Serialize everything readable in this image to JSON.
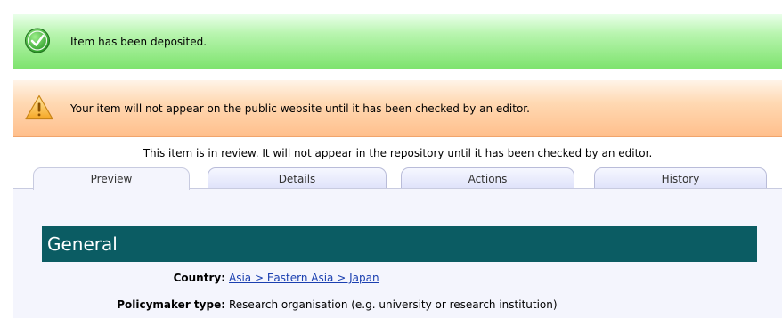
{
  "messages": {
    "success": "Item has been deposited.",
    "warning": "Your item will not appear on the public website until it has been checked by an editor."
  },
  "review_note": "This item is in review. It will not appear in the repository until it has been checked by an editor.",
  "tabs": [
    {
      "label": "Preview",
      "active": true
    },
    {
      "label": "Details",
      "active": false
    },
    {
      "label": "Actions",
      "active": false
    },
    {
      "label": "History",
      "active": false
    }
  ],
  "section": {
    "title": "General",
    "fields": [
      {
        "label": "Country:",
        "value": "Asia > Eastern Asia > Japan",
        "is_link": true
      },
      {
        "label": "Policymaker type:",
        "value": "Research organisation (e.g. university or research institution)",
        "is_link": false
      }
    ]
  },
  "colors": {
    "success": "#7ee36e",
    "warning": "#ffbf8c",
    "section_header": "#0b5c63",
    "link": "#1a3fb0"
  },
  "icons": {
    "success": "check-circle-icon",
    "warning": "warning-triangle-icon"
  }
}
